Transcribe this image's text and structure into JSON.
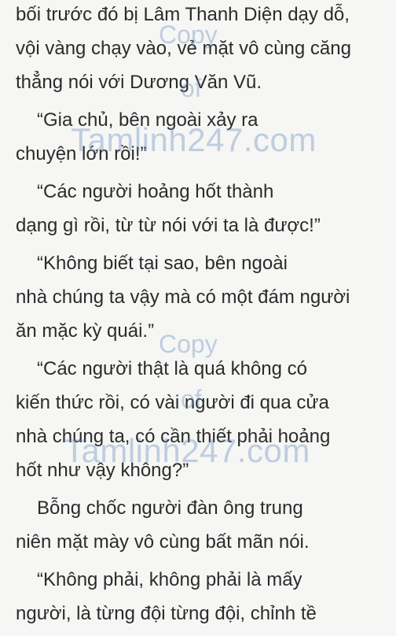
{
  "document": {
    "lines": [
      "bối trước đó bị Lâm Thanh Diện dạy dỗ,",
      "vội vàng chạy vào, vẻ mặt vô cùng căng",
      "thẳng nói với Dương Văn Vũ.",
      "“Gia chủ, bên ngoài xảy ra",
      "chuyện lớn rồi!”",
      "“Các người hoảng hốt thành",
      "dạng gì rồi, từ từ nói với ta là được!”",
      "“Không biết tại sao, bên ngoài",
      "nhà chúng ta vậy mà có một đám người",
      "ăn mặc kỳ quái.”",
      "“Các người thật là quá không có",
      "kiến thức rồi, có vài người đi qua cửa",
      "nhà chúng ta, có cần thiết phải hoảng",
      "hốt như vậy không?”",
      "Bỗng chốc người đàn ông trung",
      "niên mặt mày vô cùng bất mãn nói.",
      "“Không phải, không phải là mấy",
      "người, là từng đội từng đội, chỉnh tề"
    ]
  },
  "watermarks": [
    {
      "copy": "Copy",
      "of": "of",
      "site": "Tamlinh247.com"
    },
    {
      "copy": "Copy",
      "of": "of",
      "site": "Tamlinh247.com"
    }
  ],
  "colors": {
    "background": "#f6f6f4",
    "text": "#2b2b2b",
    "watermark": "rgba(100,140,190,0.38)"
  }
}
